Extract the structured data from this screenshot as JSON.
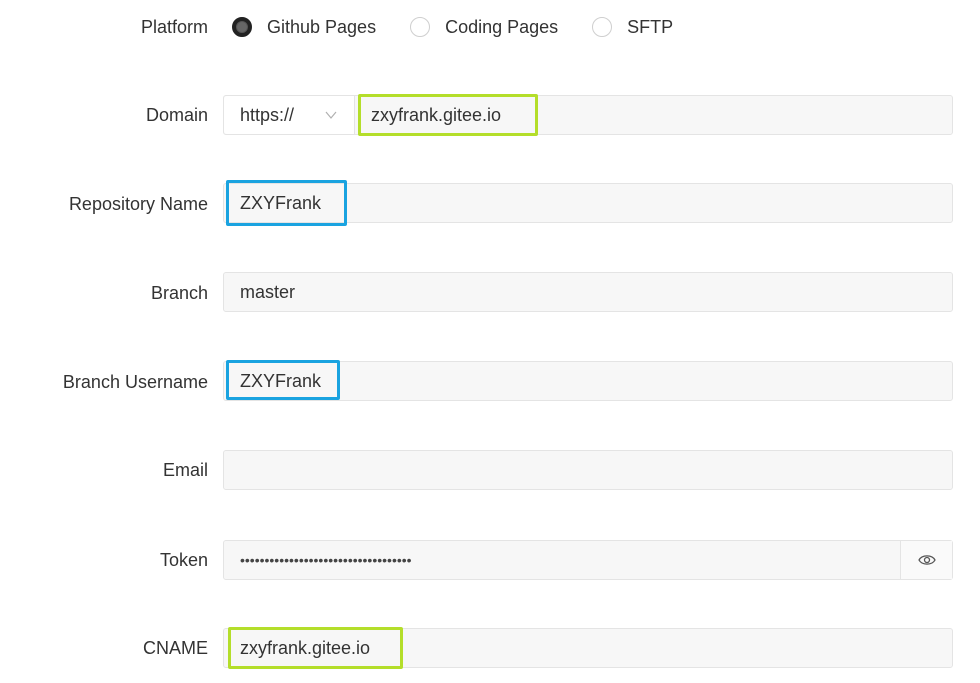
{
  "platform": {
    "label": "Platform",
    "options": [
      {
        "label": "Github Pages",
        "checked": true
      },
      {
        "label": "Coding Pages",
        "checked": false
      },
      {
        "label": "SFTP",
        "checked": false
      }
    ]
  },
  "domain": {
    "label": "Domain",
    "protocol": "https://",
    "value": "zxyfrank.gitee.io"
  },
  "repository": {
    "label": "Repository Name",
    "value": "ZXYFrank"
  },
  "branch": {
    "label": "Branch",
    "value": "master"
  },
  "branch_username": {
    "label": "Branch Username",
    "value": "ZXYFrank"
  },
  "email": {
    "label": "Email",
    "value": ""
  },
  "token": {
    "label": "Token",
    "value": "•••••••••••••••••••••••••••••••••••",
    "toggle_icon": "eye-icon"
  },
  "cname": {
    "label": "CNAME",
    "value": "zxyfrank.gitee.io"
  },
  "colors": {
    "highlight_green": "#b4de2a",
    "highlight_blue": "#1aa3e0",
    "field_bg": "#f7f7f7",
    "field_border": "#e4e4e4"
  }
}
